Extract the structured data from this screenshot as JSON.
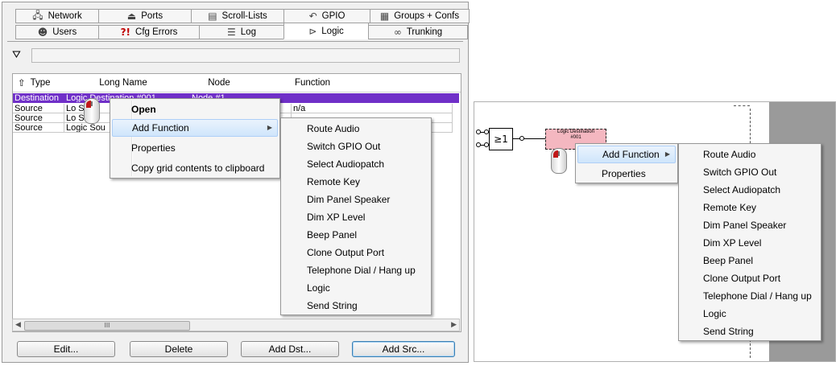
{
  "tabs_row1": [
    {
      "label": "Network",
      "icon": "network-icon"
    },
    {
      "label": "Ports",
      "icon": "ports-icon"
    },
    {
      "label": "Scroll-Lists",
      "icon": "scroll-lists-icon"
    },
    {
      "label": "GPIO",
      "icon": "gpio-icon"
    },
    {
      "label": "Groups + Confs",
      "icon": "groups-icon"
    }
  ],
  "tabs_row2": [
    {
      "label": "Users",
      "icon": "users-icon"
    },
    {
      "label": "Cfg Errors",
      "icon": "cfg-errors-icon",
      "glyph": "?!"
    },
    {
      "label": "Log",
      "icon": "log-icon"
    },
    {
      "label": "Logic",
      "icon": "logic-icon",
      "active": true
    },
    {
      "label": "Trunking",
      "icon": "trunking-icon"
    }
  ],
  "grid": {
    "columns": [
      "Type",
      "Long Name",
      "Node",
      "Function"
    ],
    "rows": [
      {
        "type": "Destination",
        "long_name": "Logic Destination #001",
        "node": "Node #1",
        "function": ""
      },
      {
        "type": "Source",
        "long_name": "Lo  Sou",
        "node": "",
        "function": "n/a"
      },
      {
        "type": "Source",
        "long_name": "Lo  Sou",
        "node": "",
        "function": ""
      },
      {
        "type": "Source",
        "long_name": "Logic Sou",
        "node": "",
        "function": ""
      }
    ]
  },
  "buttons": {
    "edit": "Edit...",
    "delete": "Delete",
    "add_dst": "Add Dst...",
    "add_src": "Add Src..."
  },
  "context_menu": {
    "items": [
      "Open",
      "Add Function",
      "Properties",
      "Copy grid contents to clipboard"
    ]
  },
  "submenu_items": [
    "Route Audio",
    "Switch GPIO Out",
    "Select Audiopatch",
    "Remote Key",
    "Dim Panel Speaker",
    "Dim XP Level",
    "Beep Panel",
    "Clone Output Port",
    "Telephone Dial / Hang up",
    "Logic",
    "Send String"
  ],
  "right_panel": {
    "gate_label": "≥1",
    "block_label_1": "Logic Destination",
    "block_label_2": "#001",
    "menu_items": [
      "Add Function",
      "Properties"
    ]
  },
  "scrollbar_label": "III"
}
